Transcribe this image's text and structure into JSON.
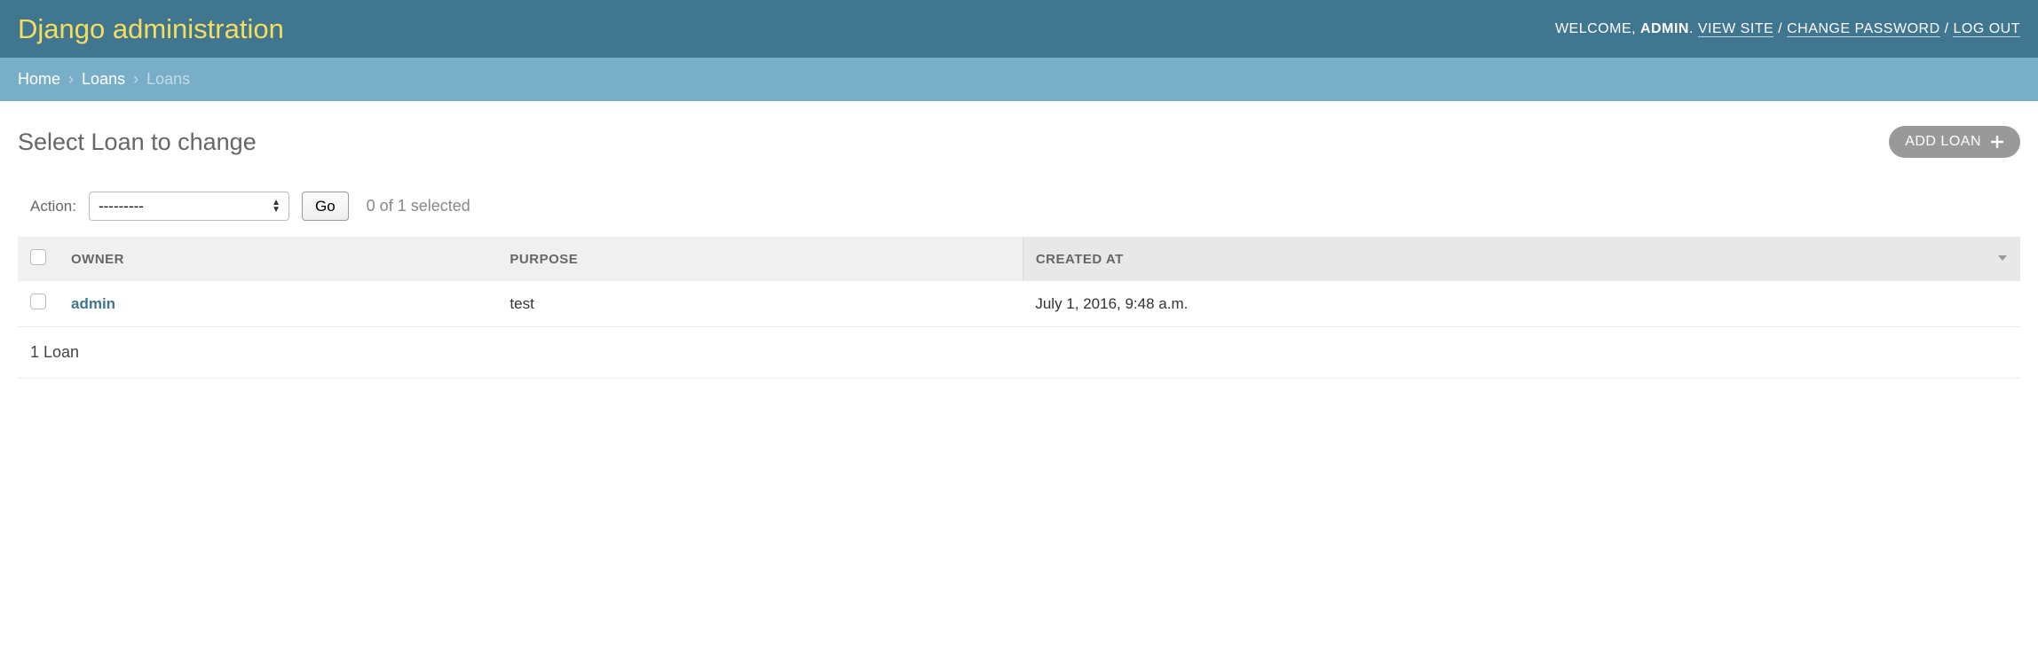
{
  "header": {
    "branding": "Django administration",
    "welcome_prefix": "WELCOME, ",
    "username": "ADMIN",
    "dot_sep": ". ",
    "view_site": "VIEW SITE",
    "slash": " / ",
    "change_password": "CHANGE PASSWORD",
    "logout": "LOG OUT"
  },
  "breadcrumbs": {
    "home": "Home",
    "sep": "›",
    "app": "Loans",
    "current": "Loans"
  },
  "page": {
    "title": "Select Loan to change",
    "add_button": "ADD LOAN"
  },
  "actions": {
    "label": "Action:",
    "selected_option": "---------",
    "go": "Go",
    "counter": "0 of 1 selected"
  },
  "table": {
    "headers": {
      "owner": "OWNER",
      "purpose": "PURPOSE",
      "created_at": "CREATED AT"
    },
    "rows": [
      {
        "owner": "admin",
        "purpose": "test",
        "created_at": "July 1, 2016, 9:48 a.m."
      }
    ]
  },
  "paginator": {
    "summary": "1 Loan"
  }
}
